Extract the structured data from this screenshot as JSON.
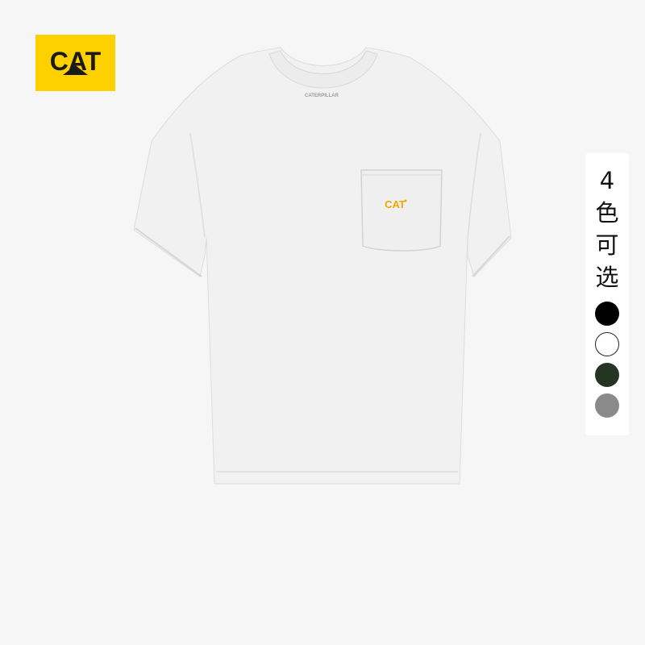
{
  "brand": {
    "logo_text": "CAT",
    "logo_bg": "#fdd000",
    "logo_fg": "#1a1a1a"
  },
  "product": {
    "garment_color": "#f1f1f1",
    "neck_label_text": "CATERPILLAR",
    "pocket_logo_text": "CAT",
    "pocket_logo_color": "#f0a800"
  },
  "color_options": {
    "title_chars": [
      "4",
      "色",
      "可",
      "选"
    ],
    "swatches": [
      {
        "name": "black",
        "color": "#000000"
      },
      {
        "name": "white",
        "color": "#ffffff"
      },
      {
        "name": "dark-green",
        "color": "#253523"
      },
      {
        "name": "gray",
        "color": "#8a8a8a"
      }
    ]
  }
}
